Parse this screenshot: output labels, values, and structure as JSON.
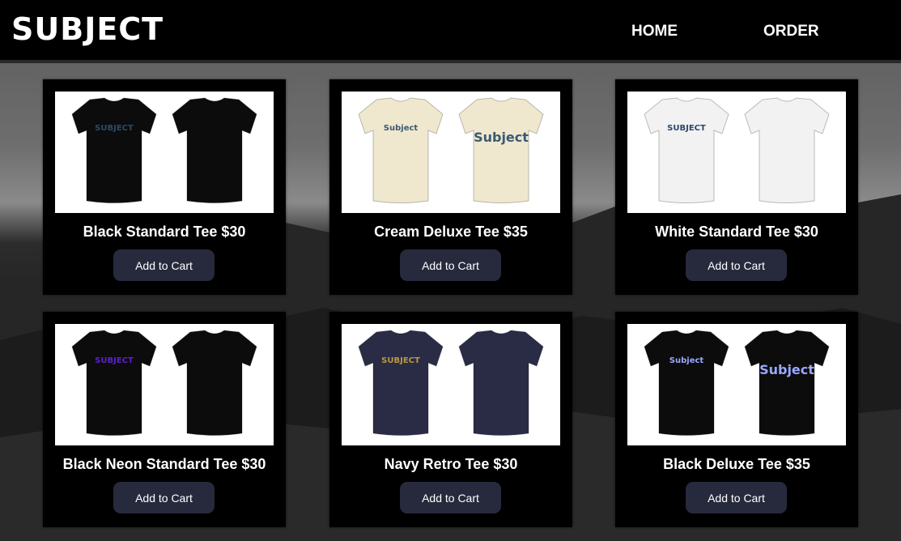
{
  "header": {
    "brand": "SUBJECT",
    "nav": {
      "home": "HOME",
      "order": "ORDER"
    }
  },
  "products": [
    {
      "title": "Black Standard Tee $30",
      "button": "Add to Cart",
      "shirt_color": "#0c0c0c",
      "front_print": "SUBJECT",
      "front_print_color": "#2a4a6a",
      "back_print": ""
    },
    {
      "title": "Cream Deluxe Tee $35",
      "button": "Add to Cart",
      "shirt_color": "#efe8cf",
      "front_print": "Subject",
      "front_print_color": "#3a5a70",
      "back_print": "Subject"
    },
    {
      "title": "White Standard Tee $30",
      "button": "Add to Cart",
      "shirt_color": "#f2f2f2",
      "front_print": "SUBJECT",
      "front_print_color": "#2a4a6a",
      "back_print": ""
    },
    {
      "title": "Black Neon Standard Tee $30",
      "button": "Add to Cart",
      "shirt_color": "#0c0c0c",
      "front_print": "SUBJECT",
      "front_print_color": "#5a22c8",
      "back_print": ""
    },
    {
      "title": "Navy Retro Tee $30",
      "button": "Add to Cart",
      "shirt_color": "#2a2c46",
      "front_print": "SUBJECT",
      "front_print_color": "#b89a40",
      "back_print": ""
    },
    {
      "title": "Black Deluxe Tee $35",
      "button": "Add to Cart",
      "shirt_color": "#0c0c0c",
      "front_print": "Subject",
      "front_print_color": "#9aa8ff",
      "back_print": "Subject"
    }
  ]
}
